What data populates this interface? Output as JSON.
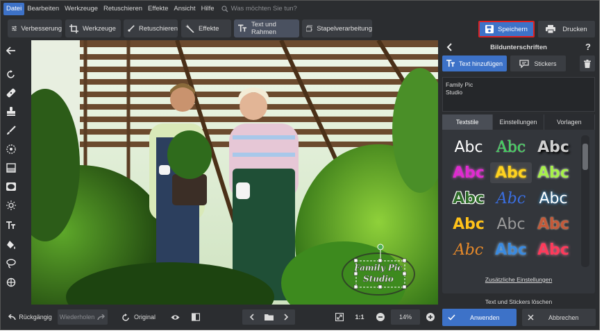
{
  "menu": {
    "items": [
      "Datei",
      "Bearbeiten",
      "Werkzeuge",
      "Retuschieren",
      "Effekte",
      "Ansicht",
      "Hilfe"
    ],
    "search_placeholder": "Was möchten Sie tun?"
  },
  "toolbar": {
    "verbesserung": "Verbesserung",
    "werkzeuge": "Werkzeuge",
    "retuschieren": "Retuschieren",
    "effekte": "Effekte",
    "text_rahmen": "Text und Rahmen",
    "stapel": "Stapelverarbeitung",
    "save": "Speichern",
    "print": "Drucken"
  },
  "canvas": {
    "watermark_text": "Family Pic Studio"
  },
  "panel": {
    "title": "Bildunterschriften",
    "help": "?",
    "add_text": "Text hinzufügen",
    "stickers": "Stickers",
    "text_content": "Family Pic\nStudio",
    "tabs": [
      "Textstile",
      "Einstellungen",
      "Vorlagen"
    ],
    "sample": "Abc",
    "more_settings": "Zusätzliche Einstellungen",
    "delete_all": "Text und Stickers löschen"
  },
  "bottom": {
    "undo": "Rückgängig",
    "redo": "Wiederholen",
    "original": "Original",
    "ratio": "1:1",
    "zoom": "14%",
    "apply": "Anwenden",
    "cancel": "Abbrechen"
  },
  "colors": {
    "accent": "#3d72c8",
    "save_border": "#e02020"
  }
}
